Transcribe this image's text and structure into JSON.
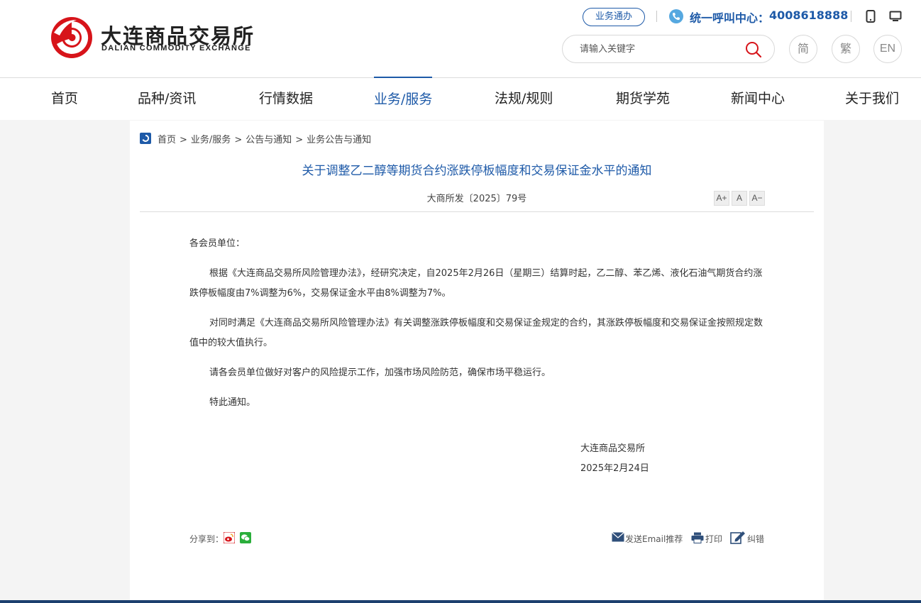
{
  "header": {
    "logo": {
      "name_cn": "大连商品交易所",
      "name_en": "DALIAN COMMODITY EXCHANGE"
    },
    "business_btn": "业务通办",
    "hotline_label": "统一呼叫中心：",
    "hotline_number": "4008618888",
    "search_placeholder": "请输入关键字",
    "lang": {
      "simplified": "简",
      "traditional": "繁",
      "english": "EN"
    }
  },
  "nav": {
    "items": [
      {
        "label": "首页"
      },
      {
        "label": "品种/资讯"
      },
      {
        "label": "行情数据"
      },
      {
        "label": "业务/服务",
        "active": true
      },
      {
        "label": "法规/规则"
      },
      {
        "label": "期货学苑"
      },
      {
        "label": "新闻中心"
      },
      {
        "label": "关于我们"
      }
    ]
  },
  "breadcrumb": [
    "首页",
    "业务/服务",
    "公告与通知",
    "业务公告与通知"
  ],
  "article": {
    "title": "关于调整乙二醇等期货合约涨跌停板幅度和交易保证金水平的通知",
    "doc_number": "大商所发〔2025〕79号",
    "font_controls": {
      "larger": "A+",
      "normal": "A",
      "smaller": "A−"
    },
    "salutation": "各会员单位：",
    "paragraphs": [
      "根据《大连商品交易所风险管理办法》，经研究决定，自2025年2月26日（星期三）结算时起，乙二醇、苯乙烯、液化石油气期货合约涨跌停板幅度由7%调整为6%，交易保证金水平由8%调整为7%。",
      "对同时满足《大连商品交易所风险管理办法》有关调整涨跌停板幅度和交易保证金规定的合约，其涨跌停板幅度和交易保证金按照规定数值中的较大值执行。",
      "请各会员单位做好对客户的风险提示工作，加强市场风险防范，确保市场平稳运行。",
      "特此通知。"
    ],
    "signature_org": "大连商品交易所",
    "signature_date": "2025年2月24日"
  },
  "footer_tools": {
    "share_label": "分享到：",
    "email": "发送Email推荐",
    "print": "打印",
    "correct": "纠错"
  },
  "colors": {
    "brand_blue": "#1e5aa8",
    "logo_red": "#d7141a",
    "bottom_bar": "#1c3f6e"
  }
}
